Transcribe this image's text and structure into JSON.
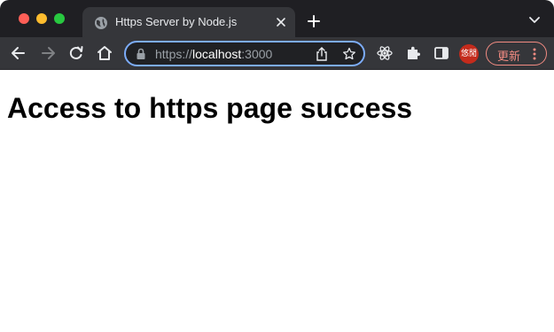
{
  "tab": {
    "title": "Https Server by Node.js",
    "favicon": "globe-icon"
  },
  "address_bar": {
    "scheme": "https://",
    "host": "localhost",
    "port": ":3000"
  },
  "profile": {
    "avatar_text": "悠閒"
  },
  "update_button": {
    "label": "更新"
  },
  "page": {
    "heading": "Access to https page success"
  },
  "colors": {
    "tabstrip_bg": "#1f1f23",
    "toolbar_bg": "#35363a",
    "omnibox_border": "#7cacf8",
    "update_accent": "#f28b82",
    "avatar_bg": "#c42b1c"
  }
}
